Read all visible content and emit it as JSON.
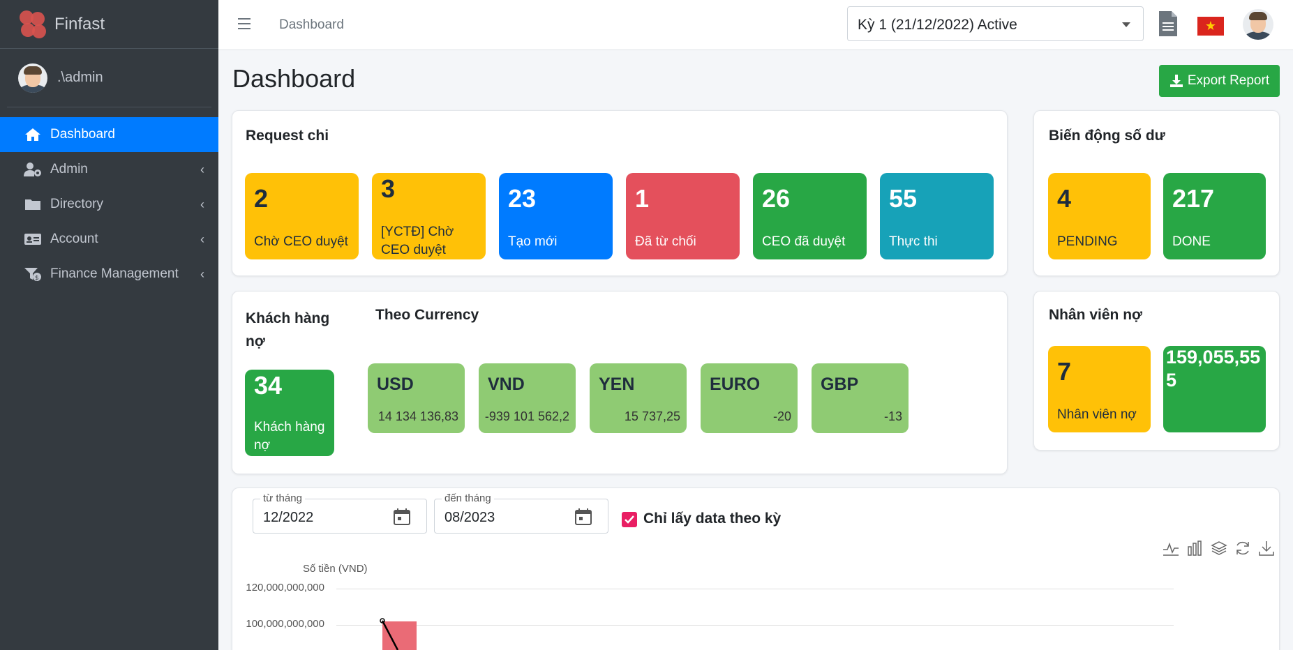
{
  "app": {
    "name": "Finfast"
  },
  "user": {
    "name": ".\\admin"
  },
  "sidebar": {
    "items": [
      {
        "label": "Dashboard",
        "active": true
      },
      {
        "label": "Admin"
      },
      {
        "label": "Directory"
      },
      {
        "label": "Account"
      },
      {
        "label": "Finance Management"
      }
    ]
  },
  "topbar": {
    "breadcrumb": "Dashboard",
    "period": "Kỳ 1 (21/12/2022) Active"
  },
  "page": {
    "title": "Dashboard",
    "export_label": "Export Report"
  },
  "request_chi": {
    "title": "Request chi",
    "tiles": [
      {
        "value": "2",
        "label": "Chờ CEO duyệt",
        "color": "#ffc107"
      },
      {
        "value": "3",
        "label": "[YCTĐ] Chờ CEO duyệt",
        "color": "#ffc107"
      },
      {
        "value": "23",
        "label": "Tạo mới",
        "color": "#007bff"
      },
      {
        "value": "1",
        "label": "Đã từ chối",
        "color": "#e4505c"
      },
      {
        "value": "26",
        "label": "CEO đã duyệt",
        "color": "#28a745"
      },
      {
        "value": "55",
        "label": "Thực thi",
        "color": "#17a2b8"
      }
    ]
  },
  "bien_dong": {
    "title": "Biến động số dư",
    "tiles": [
      {
        "value": "4",
        "label": "PENDING",
        "color": "#ffc107"
      },
      {
        "value": "217",
        "label": "DONE",
        "color": "#28a745"
      }
    ]
  },
  "khach_hang": {
    "title": "Khách hàng nợ",
    "tile": {
      "value": "34",
      "label": "Khách hàng nợ"
    }
  },
  "currency": {
    "title": "Theo Currency",
    "tiles": [
      {
        "code": "USD",
        "amount": "14 134 136,83"
      },
      {
        "code": "VND",
        "amount": "-939 101 562,2"
      },
      {
        "code": "YEN",
        "amount": "15 737,25"
      },
      {
        "code": "EURO",
        "amount": "-20"
      },
      {
        "code": "GBP",
        "amount": "-13"
      }
    ]
  },
  "nhan_vien": {
    "title": "Nhân viên nợ",
    "tiles": [
      {
        "value": "7",
        "label": "Nhân viên nợ"
      },
      {
        "value": "159,055,555",
        "label": ""
      }
    ]
  },
  "filters": {
    "from_label": "từ tháng",
    "from_value": "12/2022",
    "to_label": "đến tháng",
    "to_value": "08/2023",
    "checkbox_label": "Chỉ lấy data theo kỳ",
    "checkbox_checked": true
  },
  "chart_data": {
    "type": "bar",
    "ylabel": "Số tiền (VND)",
    "yticks": [
      "120,000,000,000",
      "100,000,000,000"
    ],
    "series": [
      {
        "values": [
          102000000000
        ]
      }
    ],
    "bar_color": "#ea6b76"
  }
}
